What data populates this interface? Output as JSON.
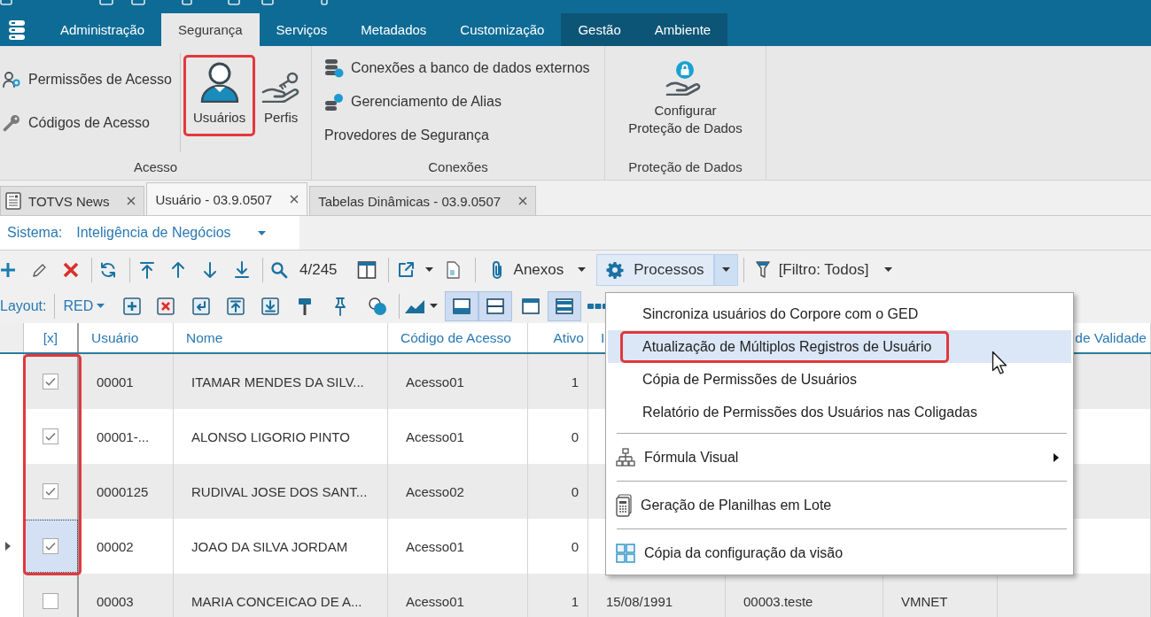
{
  "ribbon": {
    "tabs": [
      {
        "label": "Administração",
        "selected": false,
        "kind": "standard"
      },
      {
        "label": "Segurança",
        "selected": true,
        "kind": "standard"
      },
      {
        "label": "Serviços",
        "selected": false,
        "kind": "standard"
      },
      {
        "label": "Metadados",
        "selected": false,
        "kind": "standard"
      },
      {
        "label": "Customização",
        "selected": false,
        "kind": "standard"
      },
      {
        "label": "Gestão",
        "selected": false,
        "kind": "context"
      },
      {
        "label": "Ambiente",
        "selected": false,
        "kind": "context"
      }
    ],
    "groups": [
      {
        "label": "Acesso",
        "small_items": [
          {
            "label": "Permissões de Acesso"
          },
          {
            "label": "Códigos de Acesso"
          }
        ],
        "large_items": [
          {
            "label": "Usuários",
            "marked": true
          },
          {
            "label": "Perfis",
            "marked": false
          }
        ]
      },
      {
        "label": "Conexões",
        "small_items": [
          {
            "label": "Conexões a banco de dados externos"
          },
          {
            "label": "Gerenciamento de Alias"
          },
          {
            "label": "Provedores de Segurança"
          }
        ]
      },
      {
        "label": "Proteção de Dados",
        "large_items": [
          {
            "label": "Configurar\nProteção de Dados",
            "marked": false
          }
        ]
      }
    ]
  },
  "document_tabs": [
    {
      "label": "TOTVS News",
      "selected": false
    },
    {
      "label": "Usuário - 03.9.0507",
      "selected": true
    },
    {
      "label": "Tabelas Dinâmicas - 03.9.0507",
      "selected": false
    }
  ],
  "system_filter": {
    "label": "Sistema:",
    "value": "Inteligência de Negócios"
  },
  "toolbar": {
    "record_counter": "4/245",
    "attachments": "Anexos",
    "processes": {
      "label": "Processos",
      "expanded": true
    },
    "filter": "[Filtro: Todos]"
  },
  "layout_bar": {
    "label": "Layout:",
    "layout": "RED",
    "view_toggles": [
      {
        "selected": true
      },
      {
        "selected": true
      },
      {
        "selected": false
      },
      {
        "selected": true
      }
    ]
  },
  "table": {
    "checkbox_column": {
      "label": "[x]",
      "marked": true
    },
    "columns": [
      "Usuário",
      "Nome",
      "Código de Acesso",
      "Ativo",
      "I",
      null,
      null,
      "de Validade"
    ],
    "rows": [
      {
        "checked": true,
        "selected": false,
        "cells": [
          "00001",
          "ITAMAR MENDES DA SILV...",
          "Acesso01",
          "1"
        ]
      },
      {
        "checked": true,
        "selected": false,
        "cells": [
          "00001-...",
          "ALONSO LIGORIO PINTO",
          "Acesso01",
          "0"
        ]
      },
      {
        "checked": true,
        "selected": false,
        "cells": [
          "0000125",
          "RUDIVAL JOSE DOS SANT...",
          "Acesso02",
          "0"
        ]
      },
      {
        "checked": true,
        "selected": true,
        "cells": [
          "00002",
          "JOAO DA SILVA JORDAM",
          "Acesso01",
          "0"
        ]
      },
      {
        "checked": false,
        "selected": false,
        "cells": [
          "00003",
          "MARIA CONCEICAO DE A...",
          "Acesso01",
          "1",
          "15/08/1991",
          "00003.teste",
          "VMNET"
        ]
      }
    ]
  },
  "processes_menu": {
    "sections": [
      [
        {
          "label": "Sincroniza usuários do Corpore com o GED",
          "selected": false,
          "marked": false,
          "submenu": false
        },
        {
          "label": "Atualização de Múltiplos Registros de Usuário",
          "selected": true,
          "marked": true,
          "submenu": false
        },
        {
          "label": "Cópia de Permissões de Usuários",
          "selected": false,
          "marked": false,
          "submenu": false
        },
        {
          "label": "Relatório de Permissões dos Usuários nas Coligadas",
          "selected": false,
          "marked": false,
          "submenu": false
        }
      ],
      [
        {
          "label": "Fórmula Visual",
          "selected": false,
          "marked": false,
          "submenu": true
        }
      ],
      [
        {
          "label": "Geração de Planilhas em Lote",
          "selected": false,
          "marked": false,
          "submenu": false
        }
      ],
      [
        {
          "label": "Cópia da configuração da visão",
          "selected": false,
          "marked": false,
          "submenu": false
        }
      ]
    ]
  }
}
